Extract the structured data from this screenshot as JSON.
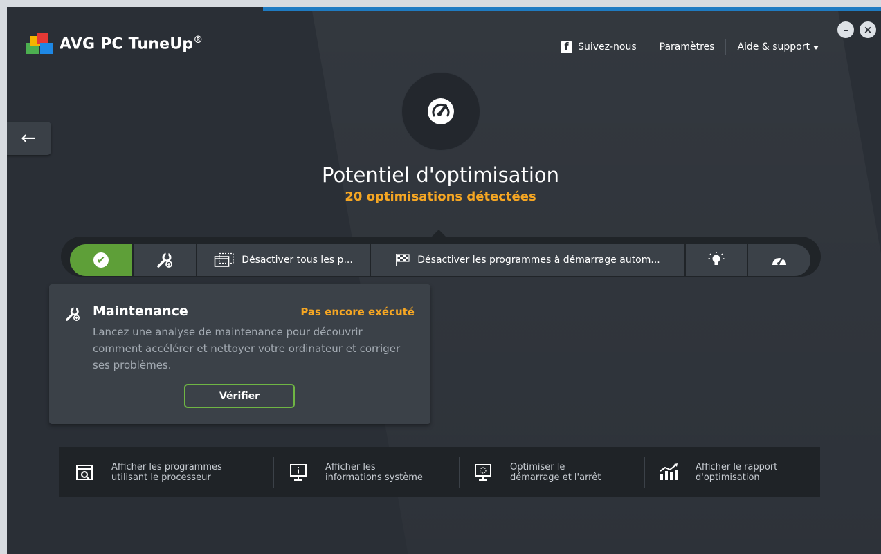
{
  "app": {
    "brand": "AVG",
    "product": "PC TuneUp",
    "registered": "®"
  },
  "header": {
    "follow_label": "Suivez-nous",
    "settings_label": "Paramètres",
    "help_label": "Aide & support",
    "fb_glyph": "f"
  },
  "window_controls": {
    "minimize": "–",
    "close": "×"
  },
  "back": {
    "glyph": "←"
  },
  "hero": {
    "title": "Potentiel d'optimisation",
    "subtitle": "20 optimisations détectées"
  },
  "toolbar": {
    "items": [
      {
        "id": "status",
        "icon": "check-icon"
      },
      {
        "id": "maintenance",
        "icon": "wrench-icon"
      },
      {
        "id": "disable-programs",
        "icon": "window-icon",
        "label": "Désactiver tous les p..."
      },
      {
        "id": "disable-startup",
        "icon": "checkered-flag-icon",
        "label": "Désactiver les programmes à démarrage autom..."
      },
      {
        "id": "tips",
        "icon": "light-bulb-icon"
      },
      {
        "id": "performance",
        "icon": "speedometer-icon"
      }
    ],
    "check_glyph": "✔"
  },
  "popup": {
    "title": "Maintenance",
    "status": "Pas encore exécuté",
    "description": "Lancez une analyse de maintenance pour découvrir comment accélérer et nettoyer votre ordinateur et corriger ses problèmes.",
    "button_label": "Vérifier"
  },
  "bottom": {
    "items": [
      {
        "line1": "Afficher les programmes",
        "line2": "utilisant le processeur",
        "icon": "process-monitor-icon"
      },
      {
        "line1": "Afficher les",
        "line2": "informations système",
        "icon": "system-info-icon"
      },
      {
        "line1": "Optimiser le",
        "line2": "démarrage et l'arrêt",
        "icon": "startup-shutdown-icon"
      },
      {
        "line1": "Afficher le rapport",
        "line2": "d'optimisation",
        "icon": "report-chart-icon"
      }
    ]
  },
  "colors": {
    "background": "#2a2f36",
    "panel": "#3b4148",
    "accent_green": "#5e9f38",
    "accent_orange": "#f5a623",
    "accent_blue": "#1f7bc2"
  }
}
